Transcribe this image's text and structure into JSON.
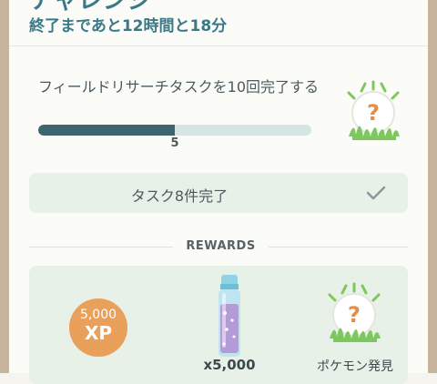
{
  "header": {
    "title": "チャレンジ",
    "time_remaining": "終了まであと12時間と18分"
  },
  "task": {
    "description": "フィールドリサーチタスクを10回完了する",
    "progress_value": 5,
    "progress_total": 10,
    "progress_label": "5"
  },
  "completed": {
    "label": "タスク8件完了"
  },
  "rewards": {
    "section_label": "REWARDS",
    "xp_amount": "5,000",
    "xp_unit": "XP",
    "stardust_quantity": "x5,000",
    "encounter_label": "ポケモン発見"
  },
  "icons": {
    "task_reward": "mystery-encounter-icon",
    "completed": "check-icon",
    "stardust": "stardust-icon"
  },
  "colors": {
    "accent_teal": "#3a7a88",
    "progress_fill": "#3e6470",
    "progress_track": "#d7e4e6",
    "panel_green": "#e7f1e8",
    "xp_orange": "#e9a05a"
  }
}
